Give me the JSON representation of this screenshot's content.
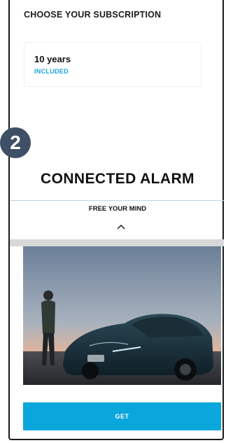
{
  "subscription": {
    "title": "CHOOSE YOUR SUBSCRIPTION",
    "plan": {
      "duration": "10 years",
      "status": "INCLUDED"
    }
  },
  "step": {
    "number": "2"
  },
  "product": {
    "title": "CONNECTED ALARM",
    "subtitle": "FREE YOUR MIND",
    "collapse_icon": "chevron-up-icon",
    "image_icon": "car-hero-image"
  },
  "actions": {
    "get_label": "GET"
  },
  "colors": {
    "accent": "#0aa7dd",
    "badge": "#3f5066",
    "included_text": "#16a5d6"
  }
}
